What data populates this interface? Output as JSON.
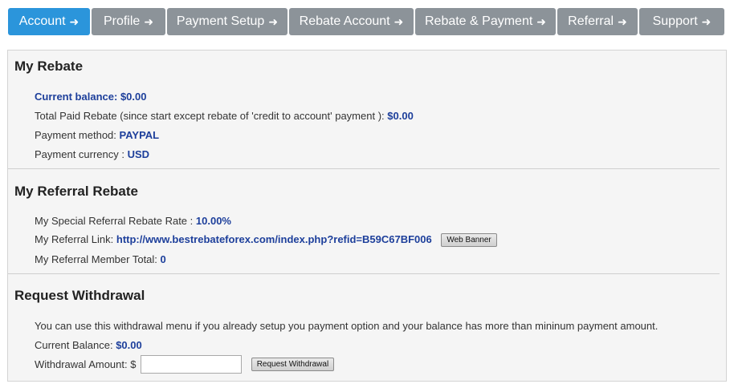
{
  "tabs": [
    {
      "label": "Account",
      "active": true
    },
    {
      "label": "Profile"
    },
    {
      "label": "Payment Setup"
    },
    {
      "label": "Rebate Account"
    },
    {
      "label": "Rebate & Payment"
    },
    {
      "label": "Referral"
    },
    {
      "label": "Support"
    }
  ],
  "my_rebate": {
    "title": "My Rebate",
    "current_balance_label": "Current balance:",
    "current_balance_value": "$0.00",
    "total_paid_label": "Total Paid Rebate (since start except rebate of 'credit to account' payment ):",
    "total_paid_value": "$0.00",
    "payment_method_label": "Payment method:",
    "payment_method_value": "PAYPAL",
    "payment_currency_label": "Payment currency :",
    "payment_currency_value": "USD"
  },
  "referral": {
    "title": "My Referral Rebate",
    "rate_label": "My Special Referral Rebate Rate :",
    "rate_value": "10.00%",
    "link_label": "My Referral Link:",
    "link_value": "http://www.bestrebateforex.com/index.php?refid=B59C67BF006",
    "web_banner_button": "Web Banner",
    "member_total_label": "My Referral Member Total:",
    "member_total_value": "0"
  },
  "withdrawal": {
    "title": "Request Withdrawal",
    "description": "You can use this withdrawal menu if you already setup you payment option and your balance has more than mininum payment amount.",
    "current_balance_label": "Current Balance:",
    "current_balance_value": "$0.00",
    "amount_label": "Withdrawal Amount: $",
    "amount_value": "",
    "request_button": "Request Withdrawal"
  },
  "colors": {
    "tab_active": "#2b95db",
    "tab_inactive": "#8c9399",
    "value_blue": "#1d3f9b",
    "panel_bg": "#f5f5f5"
  },
  "icons": {
    "tab_arrow": "arrow-right-icon"
  }
}
